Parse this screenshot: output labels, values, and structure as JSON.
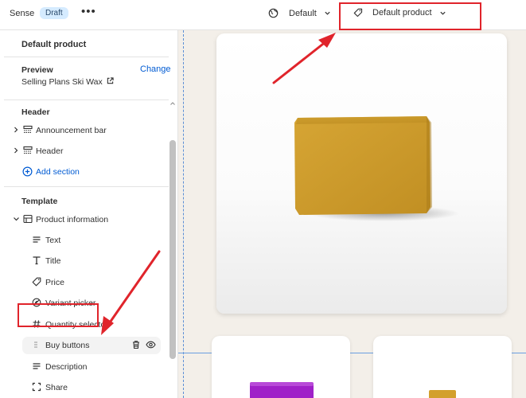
{
  "topbar": {
    "store_name": "Sense",
    "status_badge": "Draft",
    "more_label": "•••",
    "theme_selector": "Default",
    "template_selector": "Default product"
  },
  "sidebar": {
    "title": "Default product",
    "preview_label": "Preview",
    "change_link": "Change",
    "preview_value": "Selling Plans Ski Wax",
    "header_section": {
      "title": "Header",
      "items": [
        "Announcement bar",
        "Header"
      ],
      "add_section": "Add section"
    },
    "template_section": {
      "title": "Template",
      "group": "Product information",
      "blocks": [
        "Text",
        "Title",
        "Price",
        "Variant picker",
        "Quantity selector",
        "Buy buttons",
        "Description",
        "Share"
      ]
    }
  },
  "canvas": {
    "product_color": "#d3a02c",
    "variant_colors": [
      "#a020c8",
      "#d3a02c"
    ]
  },
  "annotations": {
    "highlight_color": "#e0242b"
  }
}
